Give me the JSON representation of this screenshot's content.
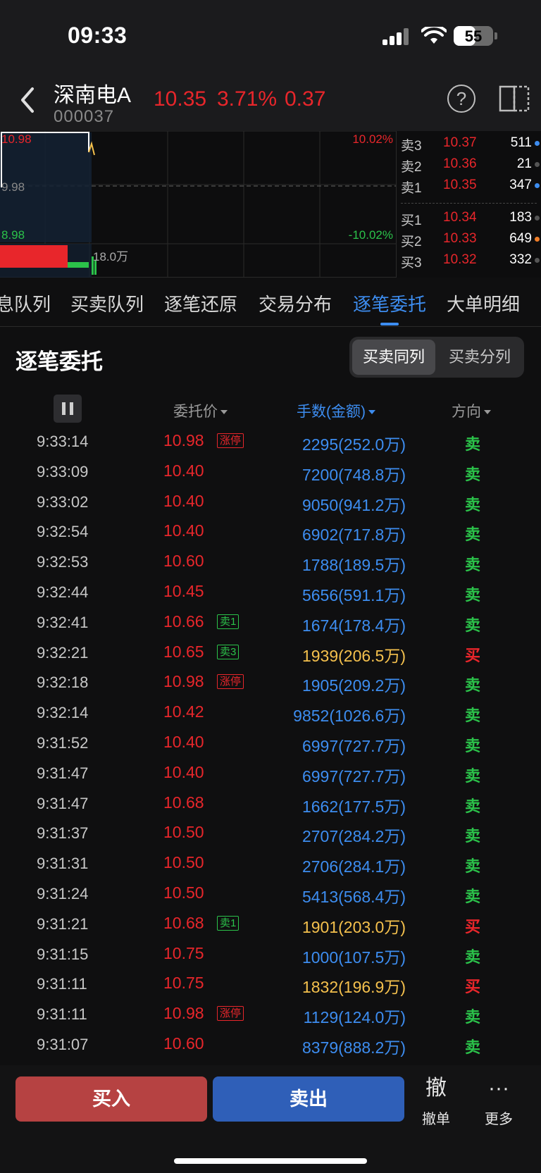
{
  "status_bar": {
    "time": "09:33",
    "battery": "55"
  },
  "header": {
    "stock_name": "深南电A",
    "stock_code": "000037",
    "price": "10.35",
    "change_pct": "3.71%",
    "change": "0.37",
    "help_icon": "?"
  },
  "chart": {
    "high_price": "10.98",
    "mid_price": "9.98",
    "low_price": "8.98",
    "high_pct": "10.02%",
    "low_pct": "-10.02%",
    "volume_label": "18.0万"
  },
  "orderbook": {
    "asks": [
      {
        "level": "卖3",
        "price": "10.37",
        "vol": "511",
        "dot": "#3d8df0"
      },
      {
        "level": "卖2",
        "price": "10.36",
        "vol": "21",
        "dot": "#555555"
      },
      {
        "level": "卖1",
        "price": "10.35",
        "vol": "347",
        "dot": "#3d8df0"
      }
    ],
    "bids": [
      {
        "level": "买1",
        "price": "10.34",
        "vol": "183",
        "dot": "#555555"
      },
      {
        "level": "买2",
        "price": "10.33",
        "vol": "649",
        "dot": "#ef7d28"
      },
      {
        "level": "买3",
        "price": "10.32",
        "vol": "332",
        "dot": "#555555"
      }
    ]
  },
  "tabs": [
    "息队列",
    "买卖队列",
    "逐笔还原",
    "交易分布",
    "逐笔委托",
    "大单明细"
  ],
  "active_tab": 4,
  "section": {
    "title": "逐笔委托",
    "seg_on": "买卖同列",
    "seg_off": "买卖分列"
  },
  "columns": {
    "price": "委托价",
    "amount": "手数(金额)",
    "direction": "方向"
  },
  "orders": [
    {
      "time": "9:33:14",
      "price": "10.98",
      "tag": "涨停",
      "tag_type": "up",
      "amount": "2295(252.0万)",
      "amount_color": "blue",
      "dir": "卖"
    },
    {
      "time": "9:33:09",
      "price": "10.40",
      "tag": "",
      "tag_type": "",
      "amount": "7200(748.8万)",
      "amount_color": "blue",
      "dir": "卖"
    },
    {
      "time": "9:33:02",
      "price": "10.40",
      "tag": "",
      "tag_type": "",
      "amount": "9050(941.2万)",
      "amount_color": "blue",
      "dir": "卖"
    },
    {
      "time": "9:32:54",
      "price": "10.40",
      "tag": "",
      "tag_type": "",
      "amount": "6902(717.8万)",
      "amount_color": "blue",
      "dir": "卖"
    },
    {
      "time": "9:32:53",
      "price": "10.60",
      "tag": "",
      "tag_type": "",
      "amount": "1788(189.5万)",
      "amount_color": "blue",
      "dir": "卖"
    },
    {
      "time": "9:32:44",
      "price": "10.45",
      "tag": "",
      "tag_type": "",
      "amount": "5656(591.1万)",
      "amount_color": "blue",
      "dir": "卖"
    },
    {
      "time": "9:32:41",
      "price": "10.66",
      "tag": "卖1",
      "tag_type": "s",
      "amount": "1674(178.4万)",
      "amount_color": "blue",
      "dir": "卖"
    },
    {
      "time": "9:32:21",
      "price": "10.65",
      "tag": "卖3",
      "tag_type": "s",
      "amount": "1939(206.5万)",
      "amount_color": "gold",
      "dir": "买"
    },
    {
      "time": "9:32:18",
      "price": "10.98",
      "tag": "涨停",
      "tag_type": "up",
      "amount": "1905(209.2万)",
      "amount_color": "blue",
      "dir": "卖"
    },
    {
      "time": "9:32:14",
      "price": "10.42",
      "tag": "",
      "tag_type": "",
      "amount": "9852(1026.6万)",
      "amount_color": "blue",
      "dir": "卖"
    },
    {
      "time": "9:31:52",
      "price": "10.40",
      "tag": "",
      "tag_type": "",
      "amount": "6997(727.7万)",
      "amount_color": "blue",
      "dir": "卖"
    },
    {
      "time": "9:31:47",
      "price": "10.40",
      "tag": "",
      "tag_type": "",
      "amount": "6997(727.7万)",
      "amount_color": "blue",
      "dir": "卖"
    },
    {
      "time": "9:31:47",
      "price": "10.68",
      "tag": "",
      "tag_type": "",
      "amount": "1662(177.5万)",
      "amount_color": "blue",
      "dir": "卖"
    },
    {
      "time": "9:31:37",
      "price": "10.50",
      "tag": "",
      "tag_type": "",
      "amount": "2707(284.2万)",
      "amount_color": "blue",
      "dir": "卖"
    },
    {
      "time": "9:31:31",
      "price": "10.50",
      "tag": "",
      "tag_type": "",
      "amount": "2706(284.1万)",
      "amount_color": "blue",
      "dir": "卖"
    },
    {
      "time": "9:31:24",
      "price": "10.50",
      "tag": "",
      "tag_type": "",
      "amount": "5413(568.4万)",
      "amount_color": "blue",
      "dir": "卖"
    },
    {
      "time": "9:31:21",
      "price": "10.68",
      "tag": "卖1",
      "tag_type": "s",
      "amount": "1901(203.0万)",
      "amount_color": "gold",
      "dir": "买"
    },
    {
      "time": "9:31:15",
      "price": "10.75",
      "tag": "",
      "tag_type": "",
      "amount": "1000(107.5万)",
      "amount_color": "blue",
      "dir": "卖"
    },
    {
      "time": "9:31:11",
      "price": "10.75",
      "tag": "",
      "tag_type": "",
      "amount": "1832(196.9万)",
      "amount_color": "gold",
      "dir": "买"
    },
    {
      "time": "9:31:11",
      "price": "10.98",
      "tag": "涨停",
      "tag_type": "up",
      "amount": "1129(124.0万)",
      "amount_color": "blue",
      "dir": "卖"
    },
    {
      "time": "9:31:07",
      "price": "10.60",
      "tag": "",
      "tag_type": "",
      "amount": "8379(888.2万)",
      "amount_color": "blue",
      "dir": "卖"
    }
  ],
  "bottom": {
    "buy": "买入",
    "sell": "卖出",
    "cancel_icon": "撤",
    "cancel_label": "撤单",
    "more_icon": "···",
    "more_label": "更多"
  }
}
